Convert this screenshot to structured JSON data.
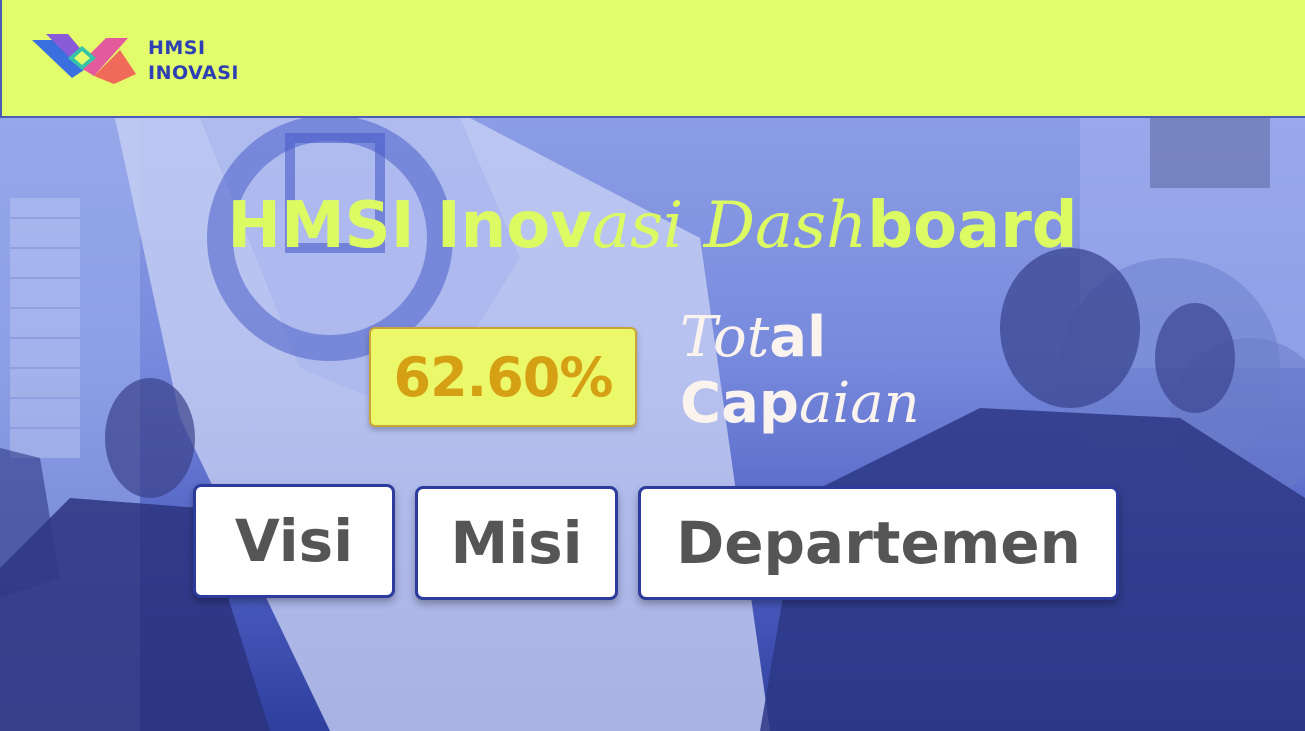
{
  "header": {
    "logo_line1": "HMSI",
    "logo_line2": "INOVASI",
    "logo_icon": "hmsi-logo-icon"
  },
  "hero": {
    "title_part1": "HMSI Inov",
    "title_part2": "asi Dash",
    "title_part3": "board",
    "percent": "62.60%",
    "total_part1": "Tot",
    "total_part2": "al",
    "capaian_part1": "Cap",
    "capaian_part2": "aian"
  },
  "nav": {
    "visi": "Visi",
    "misi": "Misi",
    "departemen": "Departemen"
  },
  "colors": {
    "header_bg": "#e3fc6b",
    "brand_blue": "#2e3fb3",
    "title_green": "#dcfb63",
    "percent_text": "#d6a014",
    "button_text": "#555555"
  }
}
